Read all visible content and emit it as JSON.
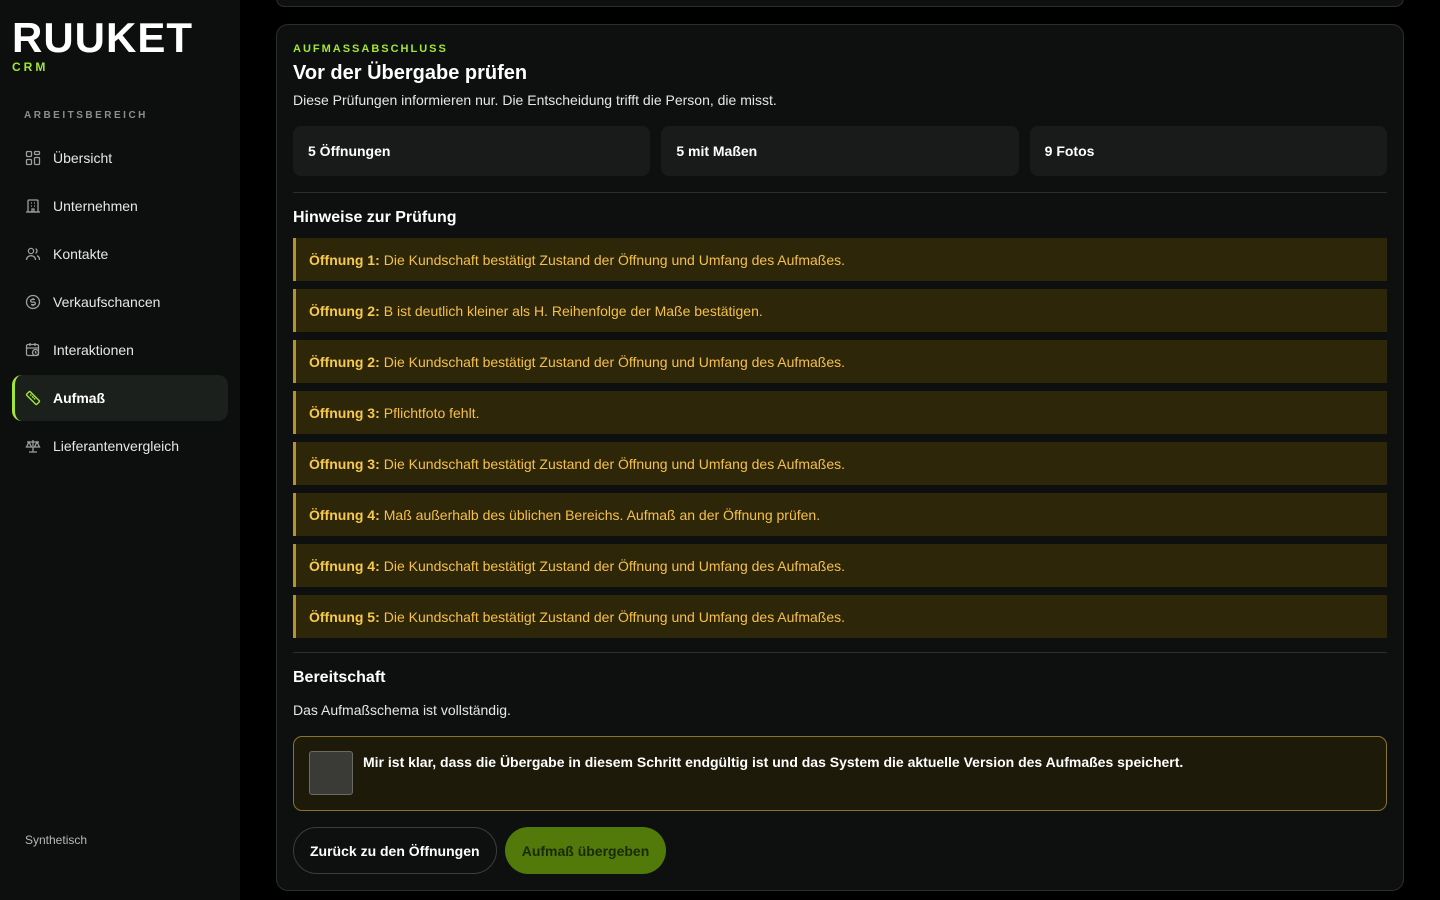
{
  "brand": {
    "name": "RUUKET",
    "sub": "CRM"
  },
  "sidebar": {
    "section_label": "ARBEITSBEREICH",
    "items": [
      {
        "label": "Übersicht",
        "icon": "grid-icon"
      },
      {
        "label": "Unternehmen",
        "icon": "building-icon"
      },
      {
        "label": "Kontakte",
        "icon": "users-icon"
      },
      {
        "label": "Verkaufschancen",
        "icon": "dollar-circle-icon"
      },
      {
        "label": "Interaktionen",
        "icon": "calendar-clock-icon"
      },
      {
        "label": "Aufmaß",
        "icon": "ruler-icon",
        "active": true
      },
      {
        "label": "Lieferantenvergleich",
        "icon": "scale-icon"
      }
    ],
    "footer": "Synthetisch"
  },
  "main": {
    "eyebrow": "AUFMASSABSCHLUSS",
    "title": "Vor der Übergabe prüfen",
    "subtitle": "Diese Prüfungen informieren nur. Die Entscheidung trifft die Person, die misst.",
    "stats": [
      "5 Öffnungen",
      "5 mit Maßen",
      "9 Fotos"
    ],
    "hints_title": "Hinweise zur Prüfung",
    "hints": [
      {
        "label": "Öffnung 1:",
        "text": "Die Kundschaft bestätigt Zustand der Öffnung und Umfang des Aufmaßes."
      },
      {
        "label": "Öffnung 2:",
        "text": "B ist deutlich kleiner als H. Reihenfolge der Maße bestätigen."
      },
      {
        "label": "Öffnung 2:",
        "text": "Die Kundschaft bestätigt Zustand der Öffnung und Umfang des Aufmaßes."
      },
      {
        "label": "Öffnung 3:",
        "text": "Pflichtfoto fehlt."
      },
      {
        "label": "Öffnung 3:",
        "text": "Die Kundschaft bestätigt Zustand der Öffnung und Umfang des Aufmaßes."
      },
      {
        "label": "Öffnung 4:",
        "text": "Maß außerhalb des üblichen Bereichs. Aufmaß an der Öffnung prüfen."
      },
      {
        "label": "Öffnung 4:",
        "text": "Die Kundschaft bestätigt Zustand der Öffnung und Umfang des Aufmaßes."
      },
      {
        "label": "Öffnung 5:",
        "text": "Die Kundschaft bestätigt Zustand der Öffnung und Umfang des Aufmaßes."
      }
    ],
    "readiness_title": "Bereitschaft",
    "readiness_text": "Das Aufmaßschema ist vollständig.",
    "confirm_text": "Mir ist klar, dass die Übergabe in diesem Schritt endgültig ist und das System die aktuelle Version des Aufmaßes speichert.",
    "back_button": "Zurück zu den Öffnungen",
    "submit_button": "Aufmaß übergeben"
  },
  "colors": {
    "accent": "#a3e635",
    "warning_bg": "#2e2609",
    "warning_text": "#f4c04a",
    "submit_bg": "#527a0a"
  }
}
